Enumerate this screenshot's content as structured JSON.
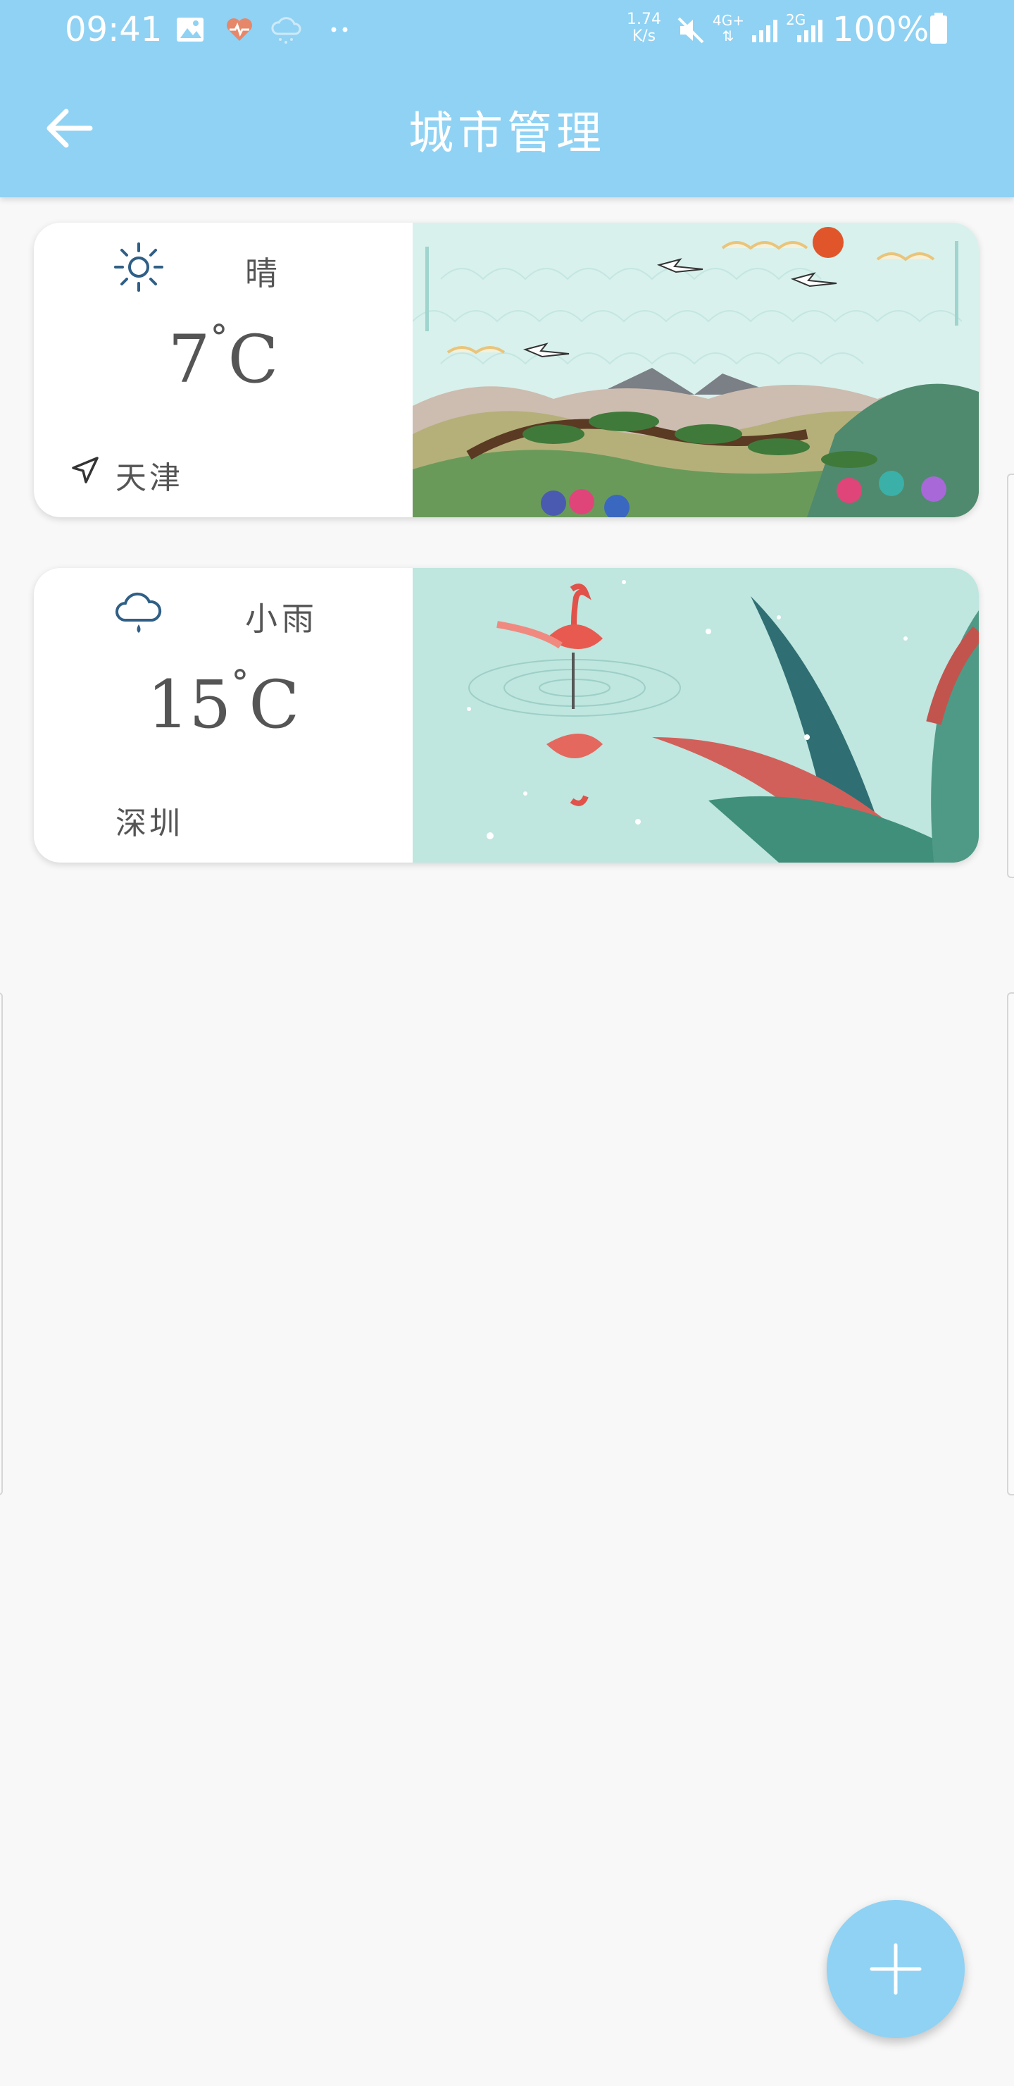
{
  "status_bar": {
    "time": "09:41",
    "net_speed_value": "1.74",
    "net_speed_unit": "K/s",
    "network_4g": "4G+",
    "network_2g": "2G",
    "battery": "100%"
  },
  "app_bar": {
    "title": "城市管理",
    "back_icon": "arrow-left-icon"
  },
  "cities": [
    {
      "condition": "晴",
      "condition_icon": "sun-icon",
      "temp_value": "7",
      "temp_unit": "C",
      "city": "天津",
      "is_location": true,
      "artwork": "landscape-cranes-art"
    },
    {
      "condition": "小雨",
      "condition_icon": "rain-cloud-icon",
      "temp_value": "15",
      "temp_unit": "C",
      "city": "深圳",
      "is_location": false,
      "artwork": "flamingo-art"
    }
  ],
  "fab": {
    "icon": "plus-icon"
  },
  "colors": {
    "primary": "#8fd2f4",
    "icon_blue": "#2f5f86",
    "text": "#555555",
    "background": "#f8f8f8"
  }
}
